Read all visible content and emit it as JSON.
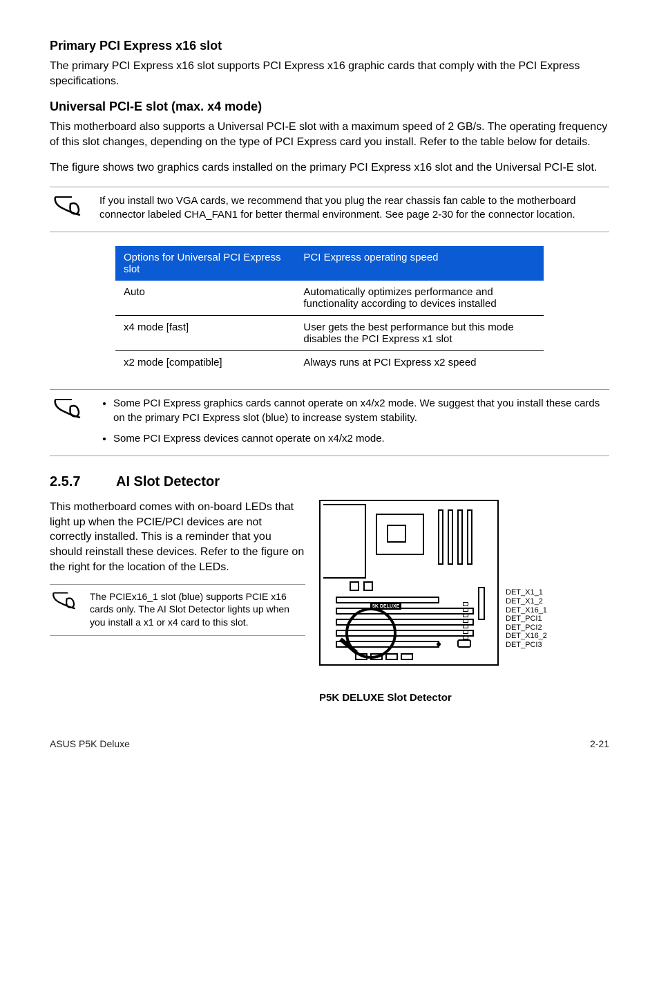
{
  "sections": {
    "primary": {
      "heading": "Primary PCI Express x16 slot",
      "body": "The primary PCI Express x16 slot supports PCI Express x16 graphic cards that comply with the PCI Express specifications."
    },
    "universal": {
      "heading": "Universal PCI-E slot (max. x4 mode)",
      "body1": "This motherboard also supports a Universal PCI-E slot with a maximum speed of 2 GB/s. The operating frequency of this slot changes, depending on the type of PCI Express card you install. Refer to the table below for details.",
      "body2": "The figure shows two graphics cards installed on the primary PCI Express x16 slot and the Universal PCI-E slot."
    }
  },
  "notes": {
    "vga": "If you install two VGA cards, we recommend that you plug the rear chassis fan cable to the motherboard connector labeled CHA_FAN1 for better thermal environment. See page 2-30 for the connector location.",
    "bullets": [
      "Some PCI Express graphics cards cannot operate on x4/x2 mode. We suggest that you install these cards on the primary PCI Express slot (blue) to increase system stability.",
      "Some PCI Express devices cannot operate on x4/x2 mode."
    ],
    "mini": "The PCIEx16_1 slot (blue) supports PCIE x16 cards only. The AI Slot Detector lights up when you install a x1 or x4 card to this slot."
  },
  "table": {
    "headers": {
      "col1": "Options for Universal PCI Express slot",
      "col2": "PCI Express operating speed"
    },
    "rows": [
      {
        "c1": "Auto",
        "c2": "Automatically optimizes performance and functionality according to devices installed"
      },
      {
        "c1": "x4 mode [fast]",
        "c2": "User gets the best performance but this mode disables the PCI Express x1 slot"
      },
      {
        "c1": "x2 mode [compatible]",
        "c2": "Always runs at PCI Express x2 speed"
      }
    ]
  },
  "ai_slot": {
    "num": "2.5.7",
    "title": "AI Slot Detector",
    "intro": "This motherboard comes with on-board LEDs that light up when the PCIE/PCI devices are not correctly installed. This is a reminder that you should reinstall these devices. Refer to the figure on the right for the location of the LEDs.",
    "diagram_inner_label": "5K DELUXE",
    "pins": [
      "DET_X1_1",
      "DET_X1_2",
      "DET_X16_1",
      "DET_PCI1",
      "DET_PCI2",
      "DET_X16_2",
      "DET_PCI3"
    ],
    "caption": "P5K DELUXE Slot Detector"
  },
  "footer": {
    "left": "ASUS P5K Deluxe",
    "right": "2-21"
  }
}
